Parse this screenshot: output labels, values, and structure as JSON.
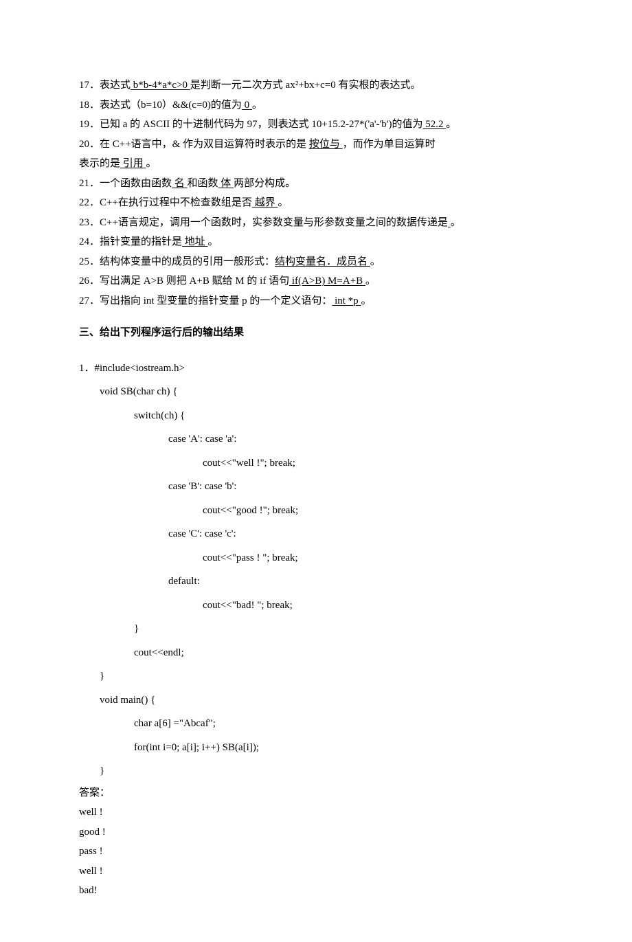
{
  "q17": {
    "num": "17．表达式",
    "ans": "  b*b-4*a*c>0",
    "pad": "                  ",
    "tail": "是判断一元二次方式 ax²+bx+c=0 有实根的表达式。"
  },
  "q18": {
    "pre": "18．表达式（b=10）&&(c=0)的值为",
    "ans": "      0",
    "pad": "         ",
    "tail": "。"
  },
  "q19": {
    "pre": "19．已知 a 的 ASCII 的十进制代码为 97，则表达式 10+15.2-27*('a'-'b')的值为",
    "ans": "  52.2",
    "pad": "        ",
    "tail": "。"
  },
  "q20": {
    "pre": "20．在 C++语言中，& 作为双目运算符时表示的是 ",
    "ans1": "  按位与",
    "pad1": "           ",
    "mid": "，而作为单目运算时",
    "pre2": "表示的是",
    "ans2": "     引用",
    "pad2": "             ",
    "tail": "。"
  },
  "q21": {
    "pre": "21．一个函数由函数",
    "ans1": "   名",
    "pad1": "       ",
    "mid": "和函数",
    "ans2": "     体",
    "pad2": "       ",
    "tail": "两部分构成。"
  },
  "q22": {
    "pre": "22．C++在执行过程中不检查数组是否",
    "ans": "  越界",
    "pad": "                 ",
    "tail": "。"
  },
  "q23": {
    "pre": "23．C++语言规定，调用一个函数时，实参数变量与形参数变量之间的数据传递是",
    "ans": "       ",
    "tail": "。"
  },
  "q24": {
    "pre": "24．指针变量的指针是",
    "ans": "   地址",
    "pad": "              ",
    "tail": "。"
  },
  "q25": {
    "pre": "25．结构体变量中的成员的引用一般形式：",
    "ans": "结构变量名．成员名",
    "pad": "           ",
    "tail": "。"
  },
  "q26": {
    "pre": "26．写出满足 A>B 则把 A+B 赋给 M 的 if 语句",
    "ans": "   if(A>B)    M=A+B",
    "pad": "                                      ",
    "tail": "。"
  },
  "q27": {
    "pre": "27．写出指向 int 型变量的指针变量 p 的一个定义语句：",
    "ans": "   int *p",
    "pad": "                   ",
    "tail": "。"
  },
  "section3": "三、给出下列程序运行后的输出结果",
  "code": {
    "l1": "1．#include<iostream.h>",
    "l2": "void SB(char ch) {",
    "l3": "switch(ch) {",
    "l4": "case 'A': case 'a':",
    "l5": "cout<<\"well !\"; break;",
    "l6": "case 'B': case 'b':",
    "l7": "cout<<\"good !\"; break;",
    "l8": "case 'C': case 'c':",
    "l9": "cout<<\"pass ! \"; break;",
    "l10": "default:",
    "l11": "cout<<\"bad! \"; break;",
    "l12": "}",
    "l13": "cout<<endl;",
    "l14": "}",
    "l15": "void main() {",
    "l16": "char a[6] =\"Abcaf\";",
    "l17": "for(int i=0; a[i]; i++) SB(a[i]);",
    "l18": "}"
  },
  "answer": {
    "label": "答案：",
    "o1": "well  !",
    "o2": "good !",
    "o3": "pass !",
    "o4": "well !",
    "o5": "bad!"
  }
}
